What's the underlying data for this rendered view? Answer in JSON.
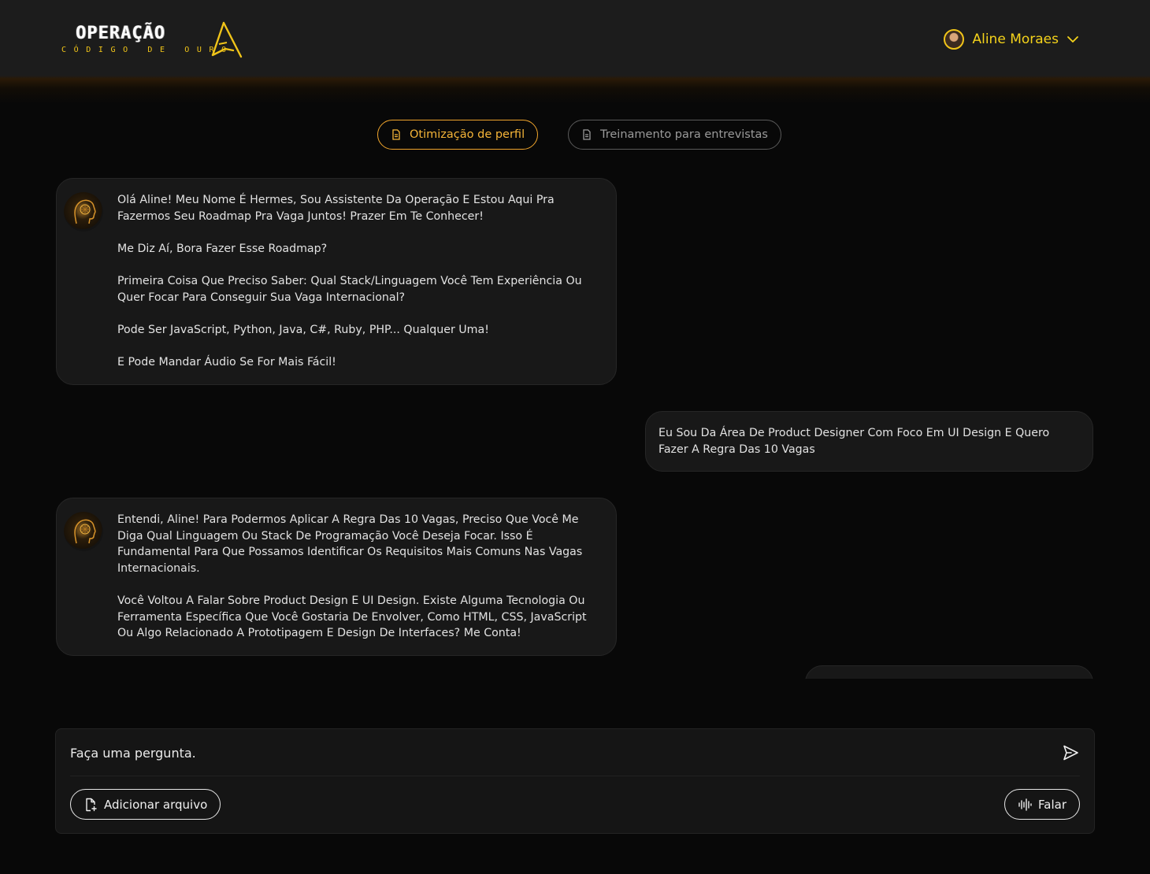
{
  "header": {
    "logo": {
      "title": "OPERAÇÃO",
      "subtitle": "CÓDIGO DE OURO"
    },
    "user": {
      "name": "Aline Moraes"
    }
  },
  "tabs": [
    {
      "label": "Otimização de perfil",
      "active": true
    },
    {
      "label": "Treinamento para entrevistas",
      "active": false
    }
  ],
  "messages": [
    {
      "sender": "bot",
      "paragraphs": [
        "Olá Aline! Meu Nome É Hermes, Sou Assistente Da Operação E Estou Aqui Pra Fazermos Seu Roadmap Pra Vaga Juntos! Prazer Em Te Conhecer!",
        "Me Diz Aí, Bora Fazer Esse Roadmap?",
        "Primeira Coisa Que Preciso Saber: Qual Stack/Linguagem Você Tem Experiência Ou Quer Focar Para Conseguir Sua Vaga Internacional?",
        "Pode Ser JavaScript, Python, Java, C#, Ruby, PHP... Qualquer Uma!",
        "E Pode Mandar Áudio Se For Mais Fácil!"
      ]
    },
    {
      "sender": "user",
      "paragraphs": [
        "Eu Sou Da Área De Product Designer Com Foco Em UI Design E Quero Fazer A Regra Das 10 Vagas"
      ]
    },
    {
      "sender": "bot",
      "paragraphs": [
        "Entendi, Aline! Para Podermos Aplicar A Regra Das 10 Vagas, Preciso Que Você Me Diga Qual Linguagem Ou Stack De Programação Você Deseja Focar. Isso É Fundamental Para Que Possamos Identificar Os Requisitos Mais Comuns Nas Vagas Internacionais.",
        "Você Voltou A Falar Sobre Product Design E UI Design. Existe Alguma Tecnologia Ou Ferramenta Específica Que Você Gostaria De Envolver, Como HTML, CSS, JavaScript Ou Algo Relacionado A Prototipagem E Design De Interfaces? Me Conta!"
      ]
    }
  ],
  "composer": {
    "placeholder": "Faça uma pergunta.",
    "attach_label": "Adicionar arquivo",
    "speak_label": "Falar"
  },
  "icons": {
    "logo": "triangle-logo-icon",
    "user_menu": "chevron-down-icon",
    "tab": "document-icon",
    "send": "send-icon",
    "attach": "file-plus-icon",
    "speak": "audio-wave-icon"
  },
  "colors": {
    "accent": "#f5d31b",
    "tab_active": "#f0a52c",
    "background": "#080808",
    "bubble": "#181818"
  }
}
